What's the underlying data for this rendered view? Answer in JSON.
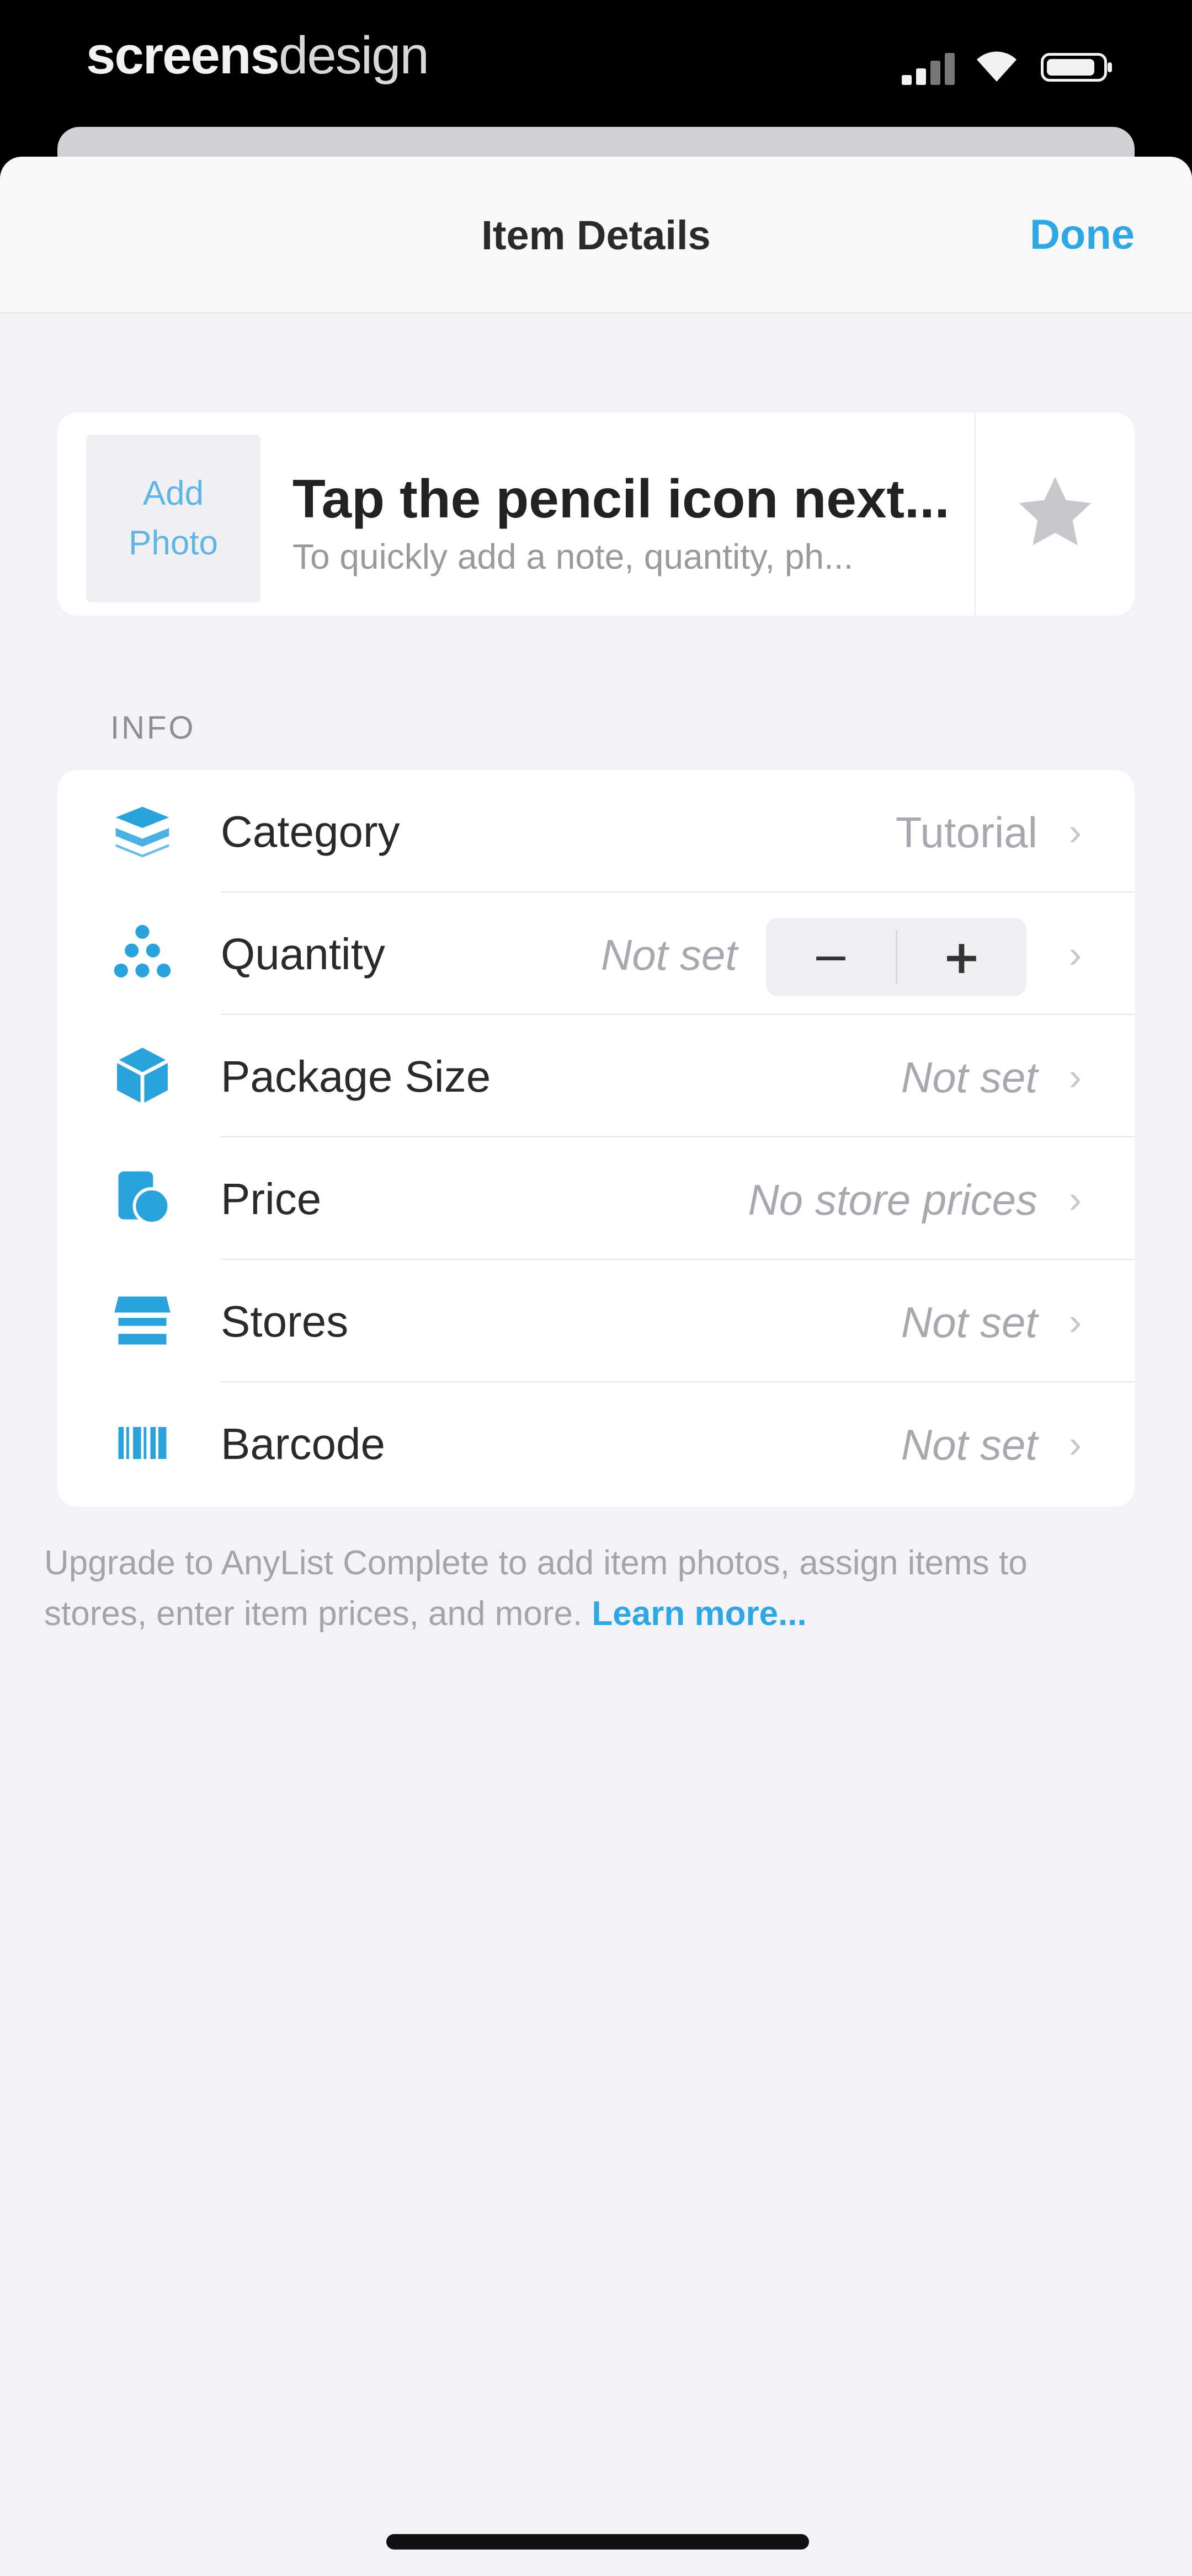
{
  "status_bar": {
    "brand_bold": "screens",
    "brand_light": "design",
    "icons": [
      "cellular-signal-icon",
      "wifi-icon",
      "battery-icon"
    ]
  },
  "navbar": {
    "title": "Item Details",
    "done_label": "Done"
  },
  "item_header": {
    "add_photo_line1": "Add",
    "add_photo_line2": "Photo",
    "title": "Tap the pencil icon next...",
    "subtitle": "To quickly add a note, quantity, ph...",
    "star_icon": "star-icon"
  },
  "info_section": {
    "label": "INFO",
    "rows": [
      {
        "label": "Category",
        "value": "Tutorial",
        "icon": "category-icon"
      },
      {
        "label": "Quantity",
        "value": "Not set",
        "icon": "quantity-icon",
        "stepper_minus": "−",
        "stepper_plus": "+"
      },
      {
        "label": "Package Size",
        "value": "Not set",
        "icon": "package-icon"
      },
      {
        "label": "Price",
        "value": "No store prices",
        "icon": "price-icon"
      },
      {
        "label": "Stores",
        "value": "Not set",
        "icon": "store-icon"
      },
      {
        "label": "Barcode",
        "value": "Not set",
        "icon": "barcode-icon"
      }
    ],
    "chevron": "›"
  },
  "footer": {
    "text": "Upgrade to AnyList Complete to add item photos, assign items to stores, enter item prices, and more.",
    "link": "Learn more..."
  },
  "colors": {
    "accent": "#2ea8e4",
    "icon_blue": "#2aa3dc",
    "background": "#f2f2f7"
  }
}
